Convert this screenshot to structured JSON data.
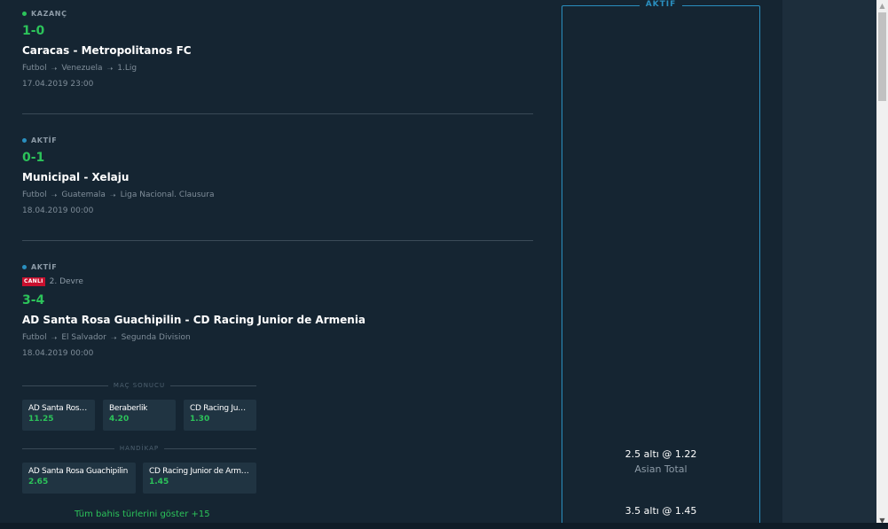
{
  "events": [
    {
      "status": "KAZANÇ",
      "status_color": "#2cc35a",
      "score": "1-0",
      "teams": "Caracas - Metropolitanos FC",
      "breadcrumb": [
        "Futbol",
        "Venezuela",
        "1.Lig"
      ],
      "date": "17.04.2019 23:00"
    },
    {
      "status": "AKTİF",
      "status_color": "#2a8fbf",
      "score": "0-1",
      "teams": "Municipal - Xelaju",
      "breadcrumb": [
        "Futbol",
        "Guatemala",
        "Liga Nacional. Clausura"
      ],
      "date": "18.04.2019 00:00"
    },
    {
      "status": "AKTİF",
      "status_color": "#2a8fbf",
      "live_badge": "CANLI",
      "period": "2. Devre",
      "score": "3-4",
      "teams": "AD Santa Rosa Guachipilin - CD Racing Junior de Armenia",
      "breadcrumb": [
        "Futbol",
        "El Salvador",
        "Segunda Division"
      ],
      "date": "18.04.2019 00:00"
    }
  ],
  "markets": [
    {
      "title": "MAÇ SONUCU",
      "odds": [
        {
          "name": "AD Santa Rosa Guachipilin",
          "value": "11.25"
        },
        {
          "name": "Beraberlik",
          "value": "4.20"
        },
        {
          "name": "CD Racing Junior de Armenia",
          "value": "1.30"
        }
      ]
    },
    {
      "title": "HANDİKAP",
      "odds": [
        {
          "name": "AD Santa Rosa Guachipilin",
          "value": "2.65"
        },
        {
          "name": "CD Racing Junior de Armenia",
          "value": "1.45"
        }
      ]
    }
  ],
  "show_all": "Tüm bahis türlerini göster +15",
  "panel": {
    "title": "AKTİF",
    "selections": [
      {
        "pick": "2.5 altı @ 1.22",
        "market": "Asian Total"
      },
      {
        "pick": "3.5 altı @ 1.45",
        "market": ""
      }
    ]
  },
  "arrow_icon": "arrow-right-icon",
  "colors": {
    "win": "#2cc35a",
    "active": "#2a8fbf",
    "live": "#c8102e"
  }
}
